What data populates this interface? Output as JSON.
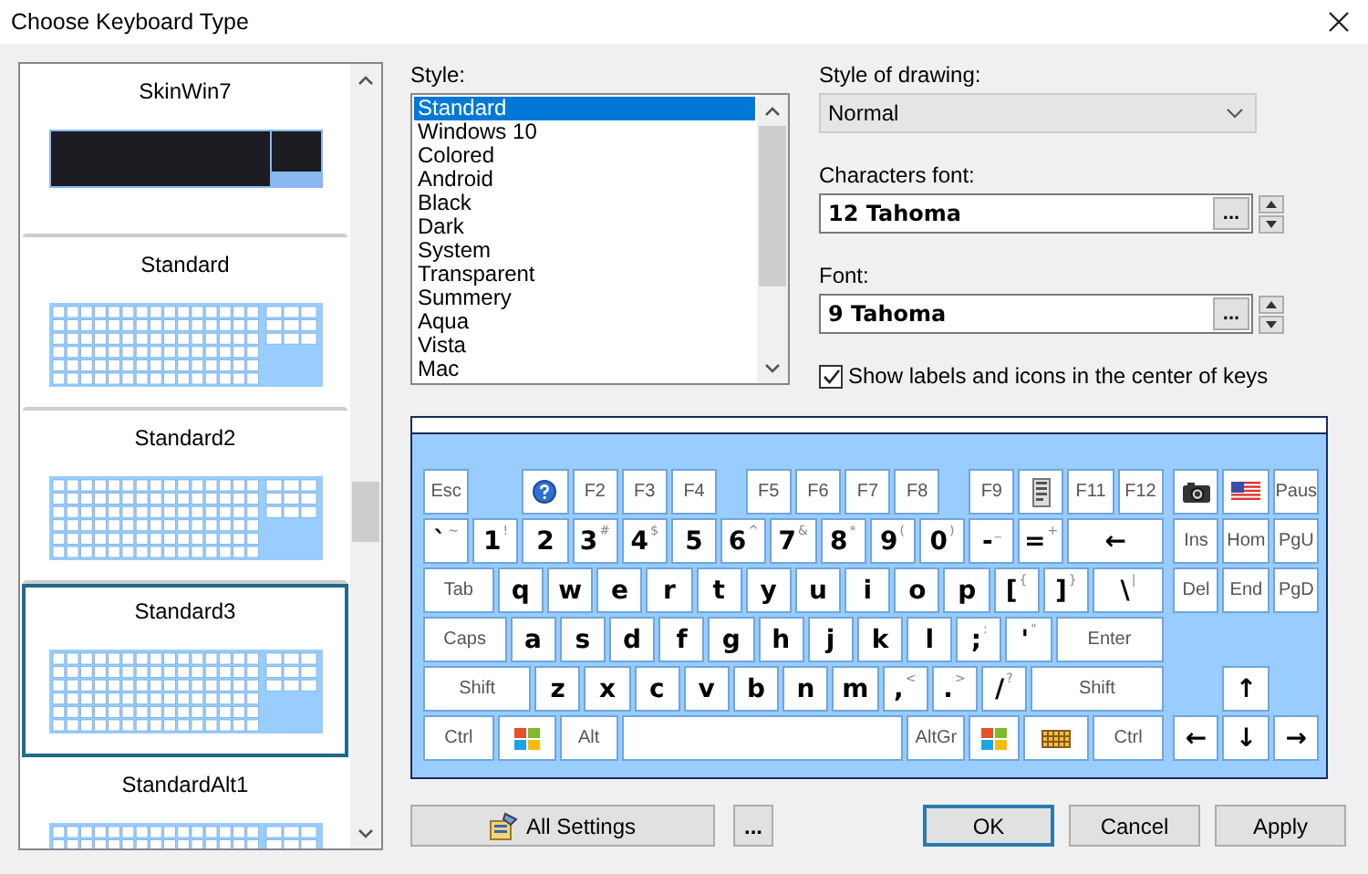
{
  "window": {
    "title": "Choose Keyboard Type"
  },
  "skins": [
    {
      "name": "SkinWin7",
      "kind": "dark",
      "selected": false
    },
    {
      "name": "Standard",
      "kind": "light",
      "selected": false
    },
    {
      "name": "Standard2",
      "kind": "light",
      "selected": false
    },
    {
      "name": "Standard3",
      "kind": "light",
      "selected": true
    },
    {
      "name": "StandardAlt1",
      "kind": "light",
      "selected": false
    }
  ],
  "style": {
    "label": "Style:",
    "items": [
      {
        "label": "Standard",
        "selected": true
      },
      {
        "label": "Windows 10",
        "selected": false
      },
      {
        "label": "Colored",
        "selected": false
      },
      {
        "label": "Android",
        "selected": false
      },
      {
        "label": "Black",
        "selected": false
      },
      {
        "label": "Dark",
        "selected": false
      },
      {
        "label": "System",
        "selected": false
      },
      {
        "label": "Transparent",
        "selected": false
      },
      {
        "label": "Summery",
        "selected": false
      },
      {
        "label": "Aqua",
        "selected": false
      },
      {
        "label": "Vista",
        "selected": false
      },
      {
        "label": "Mac",
        "selected": false
      }
    ]
  },
  "style_of_drawing": {
    "label": "Style of drawing:",
    "value": "Normal"
  },
  "characters_font": {
    "label": "Characters font:",
    "value": "12 Tahoma",
    "browse": "..."
  },
  "font": {
    "label": "Font:",
    "value": "9 Tahoma",
    "browse": "..."
  },
  "show_labels": {
    "label": "Show labels and icons in the center of keys",
    "checked": true
  },
  "keyboard": {
    "rows": [
      {
        "keys": [
          {
            "kind": "text",
            "label": "Esc"
          },
          {
            "kind": "help"
          },
          {
            "kind": "text",
            "label": "F2"
          },
          {
            "kind": "text",
            "label": "F3"
          },
          {
            "kind": "text",
            "label": "F4"
          },
          {
            "kind": "text",
            "label": "F5"
          },
          {
            "kind": "text",
            "label": "F6"
          },
          {
            "kind": "text",
            "label": "F7"
          },
          {
            "kind": "text",
            "label": "F8"
          },
          {
            "kind": "text",
            "label": "F9"
          },
          {
            "kind": "menu"
          },
          {
            "kind": "text",
            "label": "F11"
          },
          {
            "kind": "text",
            "label": "F12"
          }
        ],
        "nav": [
          {
            "kind": "camera"
          },
          {
            "kind": "flag"
          },
          {
            "kind": "text",
            "label": "Paus"
          }
        ]
      },
      {
        "keys": [
          {
            "kind": "char",
            "label": "`",
            "shift": "~"
          },
          {
            "kind": "char",
            "label": "1",
            "shift": "!"
          },
          {
            "kind": "char",
            "label": "2"
          },
          {
            "kind": "char",
            "label": "3",
            "shift": "#"
          },
          {
            "kind": "char",
            "label": "4",
            "shift": "$"
          },
          {
            "kind": "char",
            "label": "5"
          },
          {
            "kind": "char",
            "label": "6",
            "shift": "^"
          },
          {
            "kind": "char",
            "label": "7",
            "shift": "&"
          },
          {
            "kind": "char",
            "label": "8",
            "shift": "*"
          },
          {
            "kind": "char",
            "label": "9",
            "shift": "("
          },
          {
            "kind": "char",
            "label": "0",
            "shift": ")"
          },
          {
            "kind": "char",
            "label": "-",
            "shift": "_"
          },
          {
            "kind": "char",
            "label": "=",
            "shift": "+"
          },
          {
            "kind": "char",
            "label": "←"
          }
        ],
        "nav": [
          {
            "kind": "text",
            "label": "Ins"
          },
          {
            "kind": "text",
            "label": "Hom"
          },
          {
            "kind": "text",
            "label": "PgU"
          }
        ]
      },
      {
        "keys": [
          {
            "kind": "text",
            "label": "Tab"
          },
          {
            "kind": "char",
            "label": "q"
          },
          {
            "kind": "char",
            "label": "w"
          },
          {
            "kind": "char",
            "label": "e"
          },
          {
            "kind": "char",
            "label": "r"
          },
          {
            "kind": "char",
            "label": "t"
          },
          {
            "kind": "char",
            "label": "y"
          },
          {
            "kind": "char",
            "label": "u"
          },
          {
            "kind": "char",
            "label": "i"
          },
          {
            "kind": "char",
            "label": "o"
          },
          {
            "kind": "char",
            "label": "p"
          },
          {
            "kind": "char",
            "label": "[",
            "shift": "{"
          },
          {
            "kind": "char",
            "label": "]",
            "shift": "}"
          },
          {
            "kind": "char",
            "label": "\\",
            "shift": "|"
          }
        ],
        "nav": [
          {
            "kind": "text",
            "label": "Del"
          },
          {
            "kind": "text",
            "label": "End"
          },
          {
            "kind": "text",
            "label": "PgD"
          }
        ]
      },
      {
        "keys": [
          {
            "kind": "text",
            "label": "Caps"
          },
          {
            "kind": "char",
            "label": "a"
          },
          {
            "kind": "char",
            "label": "s"
          },
          {
            "kind": "char",
            "label": "d"
          },
          {
            "kind": "char",
            "label": "f"
          },
          {
            "kind": "char",
            "label": "g"
          },
          {
            "kind": "char",
            "label": "h"
          },
          {
            "kind": "char",
            "label": "j"
          },
          {
            "kind": "char",
            "label": "k"
          },
          {
            "kind": "char",
            "label": "l"
          },
          {
            "kind": "char",
            "label": ";",
            "shift": ":"
          },
          {
            "kind": "char",
            "label": "'",
            "shift": "\""
          },
          {
            "kind": "text",
            "label": "Enter"
          }
        ],
        "nav": []
      },
      {
        "keys": [
          {
            "kind": "text",
            "label": "Shift"
          },
          {
            "kind": "char",
            "label": "z"
          },
          {
            "kind": "char",
            "label": "x"
          },
          {
            "kind": "char",
            "label": "c"
          },
          {
            "kind": "char",
            "label": "v"
          },
          {
            "kind": "char",
            "label": "b"
          },
          {
            "kind": "char",
            "label": "n"
          },
          {
            "kind": "char",
            "label": "m"
          },
          {
            "kind": "char",
            "label": ",",
            "shift": "<"
          },
          {
            "kind": "char",
            "label": ".",
            "shift": ">"
          },
          {
            "kind": "char",
            "label": "/",
            "shift": "?"
          },
          {
            "kind": "text",
            "label": "Shift"
          }
        ],
        "nav": [
          {
            "kind": "char",
            "label": "↑"
          }
        ]
      },
      {
        "keys": [
          {
            "kind": "text",
            "label": "Ctrl"
          },
          {
            "kind": "windows"
          },
          {
            "kind": "text",
            "label": "Alt"
          },
          {
            "kind": "space"
          },
          {
            "kind": "text",
            "label": "AltGr"
          },
          {
            "kind": "windows"
          },
          {
            "kind": "keyboard"
          },
          {
            "kind": "text",
            "label": "Ctrl"
          }
        ],
        "nav": [
          {
            "kind": "char",
            "label": "←"
          },
          {
            "kind": "char",
            "label": "↓"
          },
          {
            "kind": "char",
            "label": "→"
          }
        ]
      }
    ]
  },
  "buttons": [
    {
      "label": "All Settings",
      "kind": "settings"
    },
    {
      "label": "...",
      "kind": "more"
    },
    {
      "label": "OK",
      "kind": "default"
    },
    {
      "label": "Cancel",
      "kind": "plain"
    },
    {
      "label": "Apply",
      "kind": "plain"
    }
  ]
}
